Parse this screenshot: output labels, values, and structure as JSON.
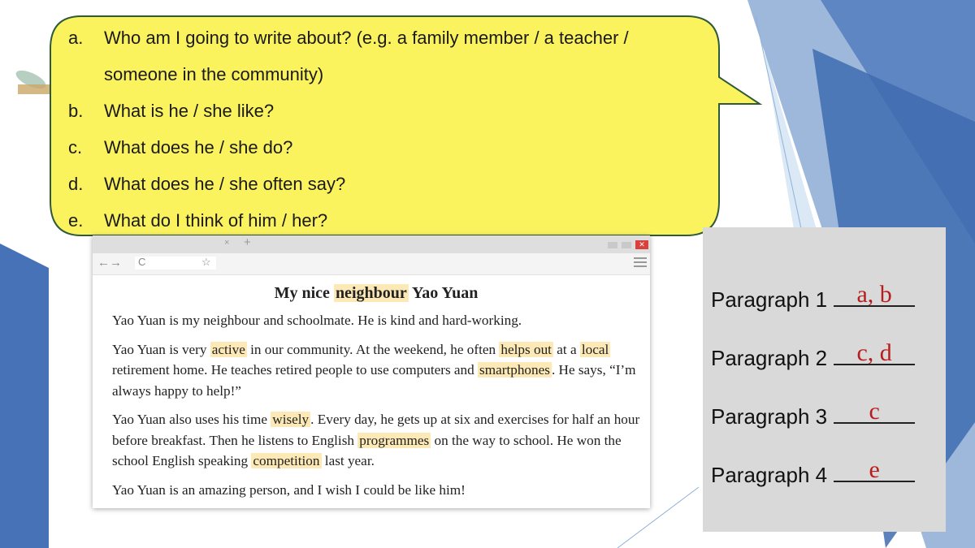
{
  "questions": [
    {
      "letter": "a.",
      "text": "Who am I going to write about? (e.g. a family member / a teacher / someone in the community)"
    },
    {
      "letter": "b.",
      "text": "What is he / she like?"
    },
    {
      "letter": "c.",
      "text": "What does he / she do?"
    },
    {
      "letter": "d.",
      "text": "What does he / she often say?"
    },
    {
      "letter": "e.",
      "text": "What do I think of him / her?"
    }
  ],
  "browser": {
    "tab_close": "×",
    "tab_new": "+",
    "nav_arrows": "←→",
    "reload": "C",
    "bookmark": "☆",
    "close": "✕"
  },
  "article": {
    "title_before": "My nice ",
    "title_highlight": "neighbour",
    "title_after": " Yao Yuan",
    "p1": "Yao Yuan is my neighbour and schoolmate. He is kind and hard-working.",
    "p2": [
      {
        "t": "Yao Yuan is very "
      },
      {
        "t": "active",
        "hl": true
      },
      {
        "t": " in our community. At the weekend, he often "
      },
      {
        "t": "helps out",
        "hl": true
      },
      {
        "t": " at a "
      },
      {
        "t": "local",
        "hl": true
      },
      {
        "t": " retirement home. He teaches retired people to use computers and "
      },
      {
        "t": "smartphones",
        "hl": true
      },
      {
        "t": ". He says, “I’m always happy to help!”"
      }
    ],
    "p3": [
      {
        "t": "Yao Yuan also uses his time "
      },
      {
        "t": "wisely",
        "hl": true
      },
      {
        "t": ". Every day, he gets up at six and exercises for half an hour before breakfast. Then he listens to English "
      },
      {
        "t": "programmes",
        "hl": true
      },
      {
        "t": " on the way to school. He won the school English speaking "
      },
      {
        "t": "competition",
        "hl": true
      },
      {
        "t": " last year."
      }
    ],
    "p4": "Yao Yuan is an amazing person, and I wish I could be like him!"
  },
  "answers": [
    {
      "label": "Paragraph 1",
      "value": "a, b"
    },
    {
      "label": "Paragraph 2",
      "value": "c, d"
    },
    {
      "label": "Paragraph 3",
      "value": "c"
    },
    {
      "label": "Paragraph 4",
      "value": "e"
    }
  ],
  "colors": {
    "bubble_fill": "#fbf35e",
    "bubble_stroke": "#2f5a3a",
    "highlight": "#fde9b5",
    "answer_text": "#b81d1d",
    "panel": "#d9d9d9"
  }
}
